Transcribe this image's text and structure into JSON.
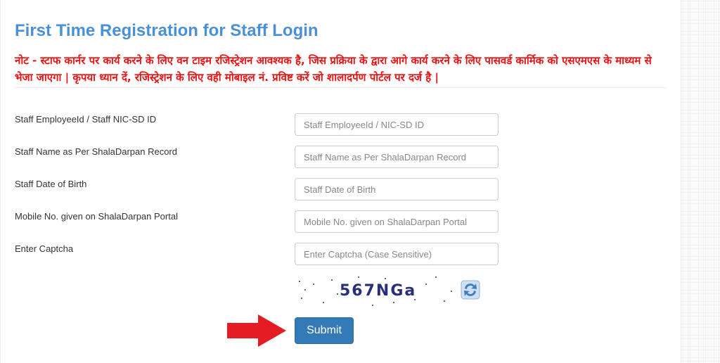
{
  "page": {
    "title": "First Time Registration for Staff Login",
    "note": "नोट - स्टाफ कार्नर पर कार्य करने के लिए वन टाइम रजिस्ट्रेशन आवश्यक है, जिस प्रक्रिया के द्वारा आगे कार्य करने के लिए पासवर्ड कार्मिक को एसएमएस के माध्यम से भेजा जाएगा | कृपया ध्यान दें, रजिस्ट्रेशन के लिए वही मोबाइल नं. प्रविष्ट करें जो शालादर्पण पोर्टल पर दर्ज है |"
  },
  "form": {
    "fields": [
      {
        "label": "Staff EmployeeId / Staff NIC-SD ID",
        "placeholder": "Staff EmployeeId / NIC-SD ID",
        "value": ""
      },
      {
        "label": "Staff Name as Per ShalaDarpan Record",
        "placeholder": "Staff Name as Per ShalaDarpan Record",
        "value": ""
      },
      {
        "label": "Staff Date of Birth",
        "placeholder": "Staff Date of Birth",
        "value": ""
      },
      {
        "label": "Mobile No. given on ShalaDarpan Portal",
        "placeholder": "Mobile No. given on ShalaDarpan Portal",
        "value": ""
      },
      {
        "label": "Enter Captcha",
        "placeholder": "Enter Captcha (Case Sensitive)",
        "value": ""
      }
    ],
    "captcha_text": "567NGa",
    "refresh_icon": "refresh-icon",
    "submit_label": "Submit"
  },
  "colors": {
    "title": "#4a90d9",
    "note": "#ee1111",
    "submit": "#337ab7",
    "arrow": "#e51c23"
  }
}
